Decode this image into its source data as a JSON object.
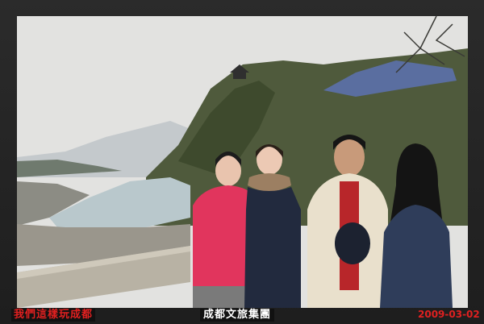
{
  "photo": {
    "scene": "travel-photo-river-valley",
    "caption_left": "我們這樣玩成都",
    "caption_center": "成都文旅集團",
    "date_stamp": "2009-03-02"
  },
  "colors": {
    "caption_red": "#e02020",
    "frame_dark": "#222222",
    "sky": "#e4e4e4",
    "river": "#b9c8cc"
  }
}
